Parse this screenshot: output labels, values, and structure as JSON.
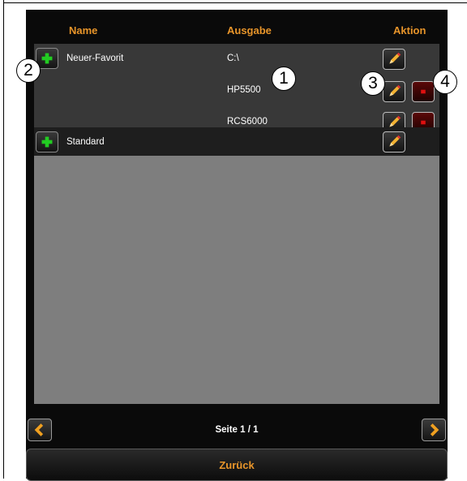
{
  "header": {
    "name": "Name",
    "output": "Ausgabe",
    "action": "Aktion"
  },
  "rows": [
    {
      "name": "Neuer-Favorit",
      "outputs": [
        "C:\\",
        "HP5500",
        "RCS6000"
      ]
    },
    {
      "name": "Standard"
    }
  ],
  "callouts": [
    "1",
    "2",
    "3",
    "4"
  ],
  "pagination": {
    "label": "Seite 1 / 1"
  },
  "back_label": "Zurück",
  "icons": {
    "add": "plus-icon",
    "edit": "pencil-icon",
    "delete": "minus-icon",
    "prev": "chevron-left-icon",
    "next": "chevron-right-icon"
  },
  "colors": {
    "accent": "#e8952a",
    "add_green": "#22cc22",
    "delete_red": "#e01010"
  }
}
